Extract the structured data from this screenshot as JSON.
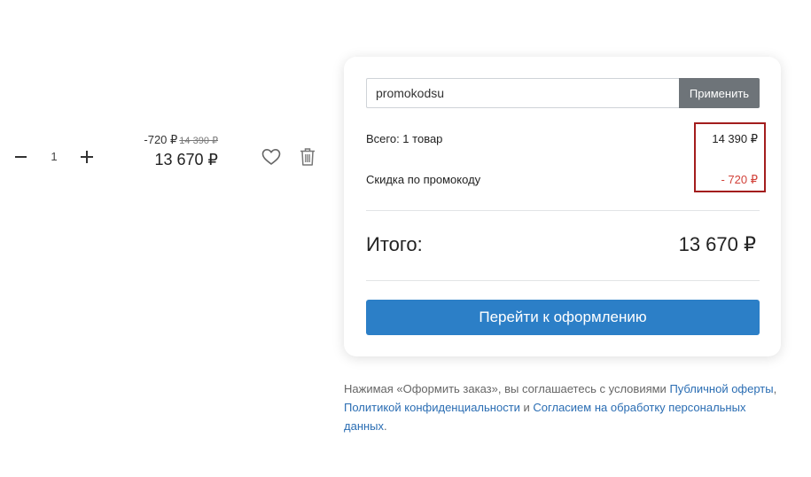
{
  "cart_item": {
    "quantity": "1",
    "discount": "-720 ₽",
    "old_price": "14 390 ₽",
    "current_price": "13 670 ₽"
  },
  "icons": {
    "minus": "minus-icon",
    "plus": "plus-icon",
    "favorite": "heart-icon",
    "delete": "trash-icon"
  },
  "summary": {
    "promo_value": "promokodsu",
    "promo_button": "Применить",
    "items_label": "Всего: 1 товар",
    "items_value": "14 390 ₽",
    "discount_label": "Скидка по промокоду",
    "discount_value": "- 720 ₽",
    "total_label": "Итого:",
    "total_value": "13 670 ₽",
    "checkout_button": "Перейти к оформлению"
  },
  "terms": {
    "prefix": "Нажимая «Оформить заказ», вы соглашаетесь с условиями ",
    "offer_link": "Публичной оферты",
    "comma": ",",
    "privacy_link": "Политикой конфиденциальности",
    "and": " и ",
    "consent_link": "Согласием на обработку персональных данных",
    "suffix": "."
  },
  "colors": {
    "accent": "#2c7fc7",
    "promo_button_bg": "#6e7479",
    "discount_red": "#d2423a",
    "highlight_border": "#a31d1d",
    "link": "#2a6db3"
  }
}
